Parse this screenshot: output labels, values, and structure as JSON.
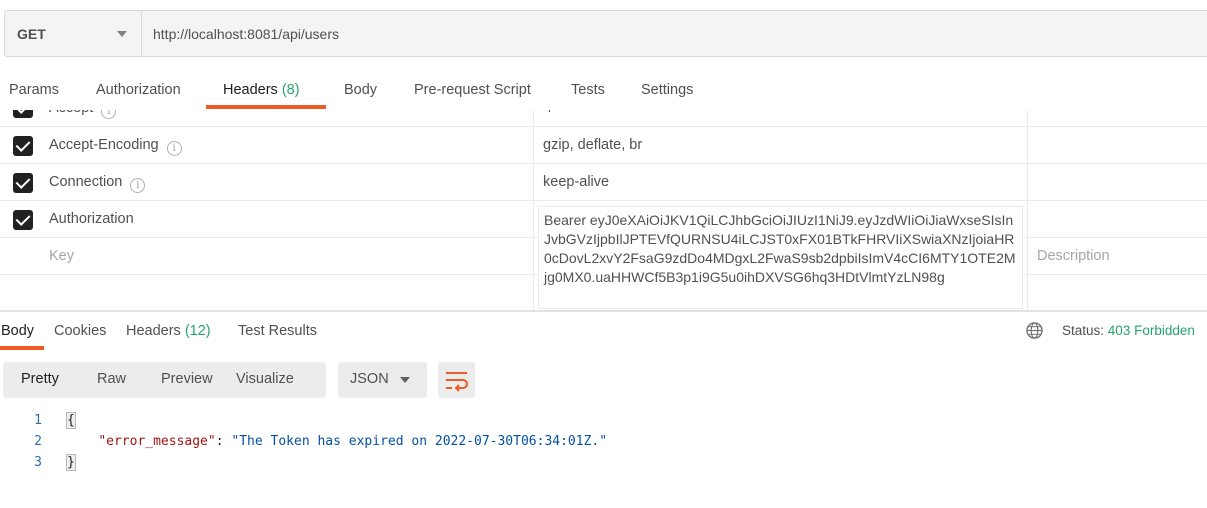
{
  "request": {
    "method": "GET",
    "url": "http://localhost:8081/api/users"
  },
  "request_tabs": [
    {
      "label": "Params"
    },
    {
      "label": "Authorization"
    },
    {
      "label": "Headers",
      "count": "(8)"
    },
    {
      "label": "Body"
    },
    {
      "label": "Pre-request Script"
    },
    {
      "label": "Tests"
    },
    {
      "label": "Settings"
    }
  ],
  "headers_table": {
    "rows": [
      {
        "key": "Accept",
        "value": "*/*"
      },
      {
        "key": "Accept-Encoding",
        "value": "gzip, deflate, br"
      },
      {
        "key": "Connection",
        "value": "keep-alive"
      },
      {
        "key": "Authorization",
        "value": "Bearer eyJ0eXAiOiJKV1QiLCJhbGciOiJIUzI1NiJ9.eyJzdWIiOiJiaWxseSIsInJvbGVzIjpbIlJPTEVfQURNSU4iLCJST0xFX01BTkFHRVIiXSwiaXNzIjoiaHR0cDovL2xvY2FsaG9zdDo4MDgxL2FwaS9sb2dpbiIsImV4cCI6MTY1OTE2Mjg0MX0.uaHHWCf5B3p1i9G5u0ihDXVSG6hq3HDtVlmtYzLN98g"
      }
    ],
    "key_placeholder": "Key",
    "description_placeholder": "Description",
    "info_glyph": "i"
  },
  "response_tabs": [
    {
      "label": "Body"
    },
    {
      "label": "Cookies"
    },
    {
      "label": "Headers",
      "count": "(12)"
    },
    {
      "label": "Test Results"
    }
  ],
  "status": {
    "label": "Status:",
    "value": "403 Forbidden",
    "color": "#26a46b"
  },
  "view_modes": [
    "Pretty",
    "Raw",
    "Preview",
    "Visualize"
  ],
  "format": "JSON",
  "code": {
    "line_numbers": [
      "1",
      "2",
      "3"
    ],
    "open_brace": "{",
    "close_brace": "}",
    "key": "\"error_message\"",
    "colon": ": ",
    "value": "\"The Token has expired on 2022-07-30T06:34:01Z.\""
  },
  "colors": {
    "accent": "#ef5b25",
    "count_green": "#26a46b"
  },
  "icons": {
    "globe": "globe-icon",
    "wrap": "wrap-lines-icon",
    "method_dropdown": "chevron-down-icon",
    "checkbox": "check-icon",
    "info": "info-icon"
  }
}
